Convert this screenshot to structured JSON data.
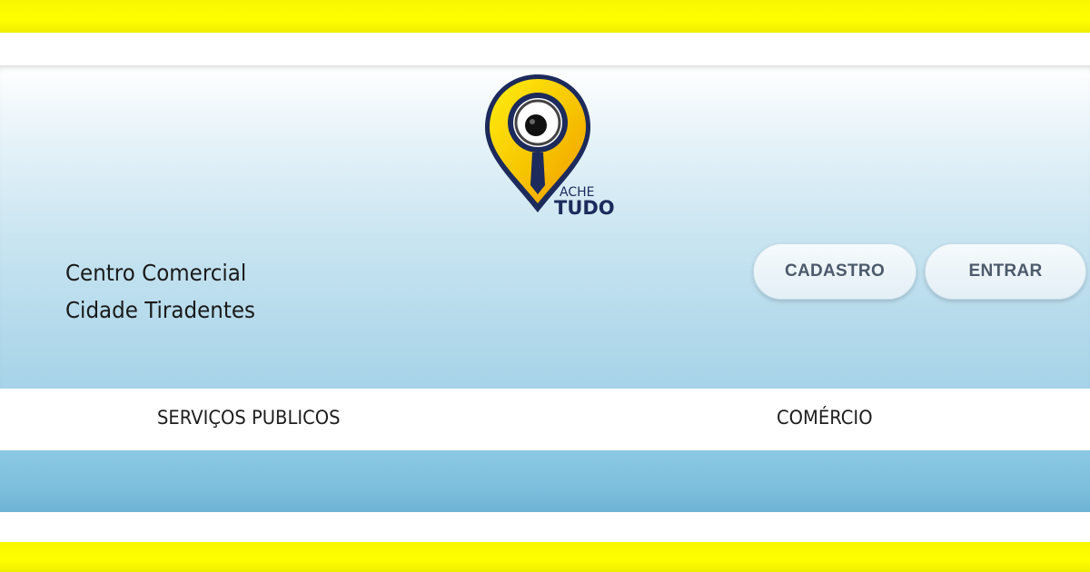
{
  "brand": {
    "logo_word_top": "ACHE",
    "logo_word_bottom": "TUDO"
  },
  "header": {
    "title_line1": "Centro Comercial",
    "title_line2": "Cidade Tiradentes"
  },
  "auth": {
    "register_label": "CADASTRO",
    "login_label": "ENTRAR"
  },
  "nav": {
    "items": [
      {
        "label": "SERVIÇOS PUBLICOS"
      },
      {
        "label": "COMÉRCIO"
      }
    ]
  },
  "colors": {
    "frame": "#ffff00",
    "accent_blue": "#7dbfdd",
    "logo_yellow": "#f7d000",
    "logo_navy": "#1c2a5c"
  },
  "icons": {
    "logo": "map-pin-magnifier-icon"
  }
}
